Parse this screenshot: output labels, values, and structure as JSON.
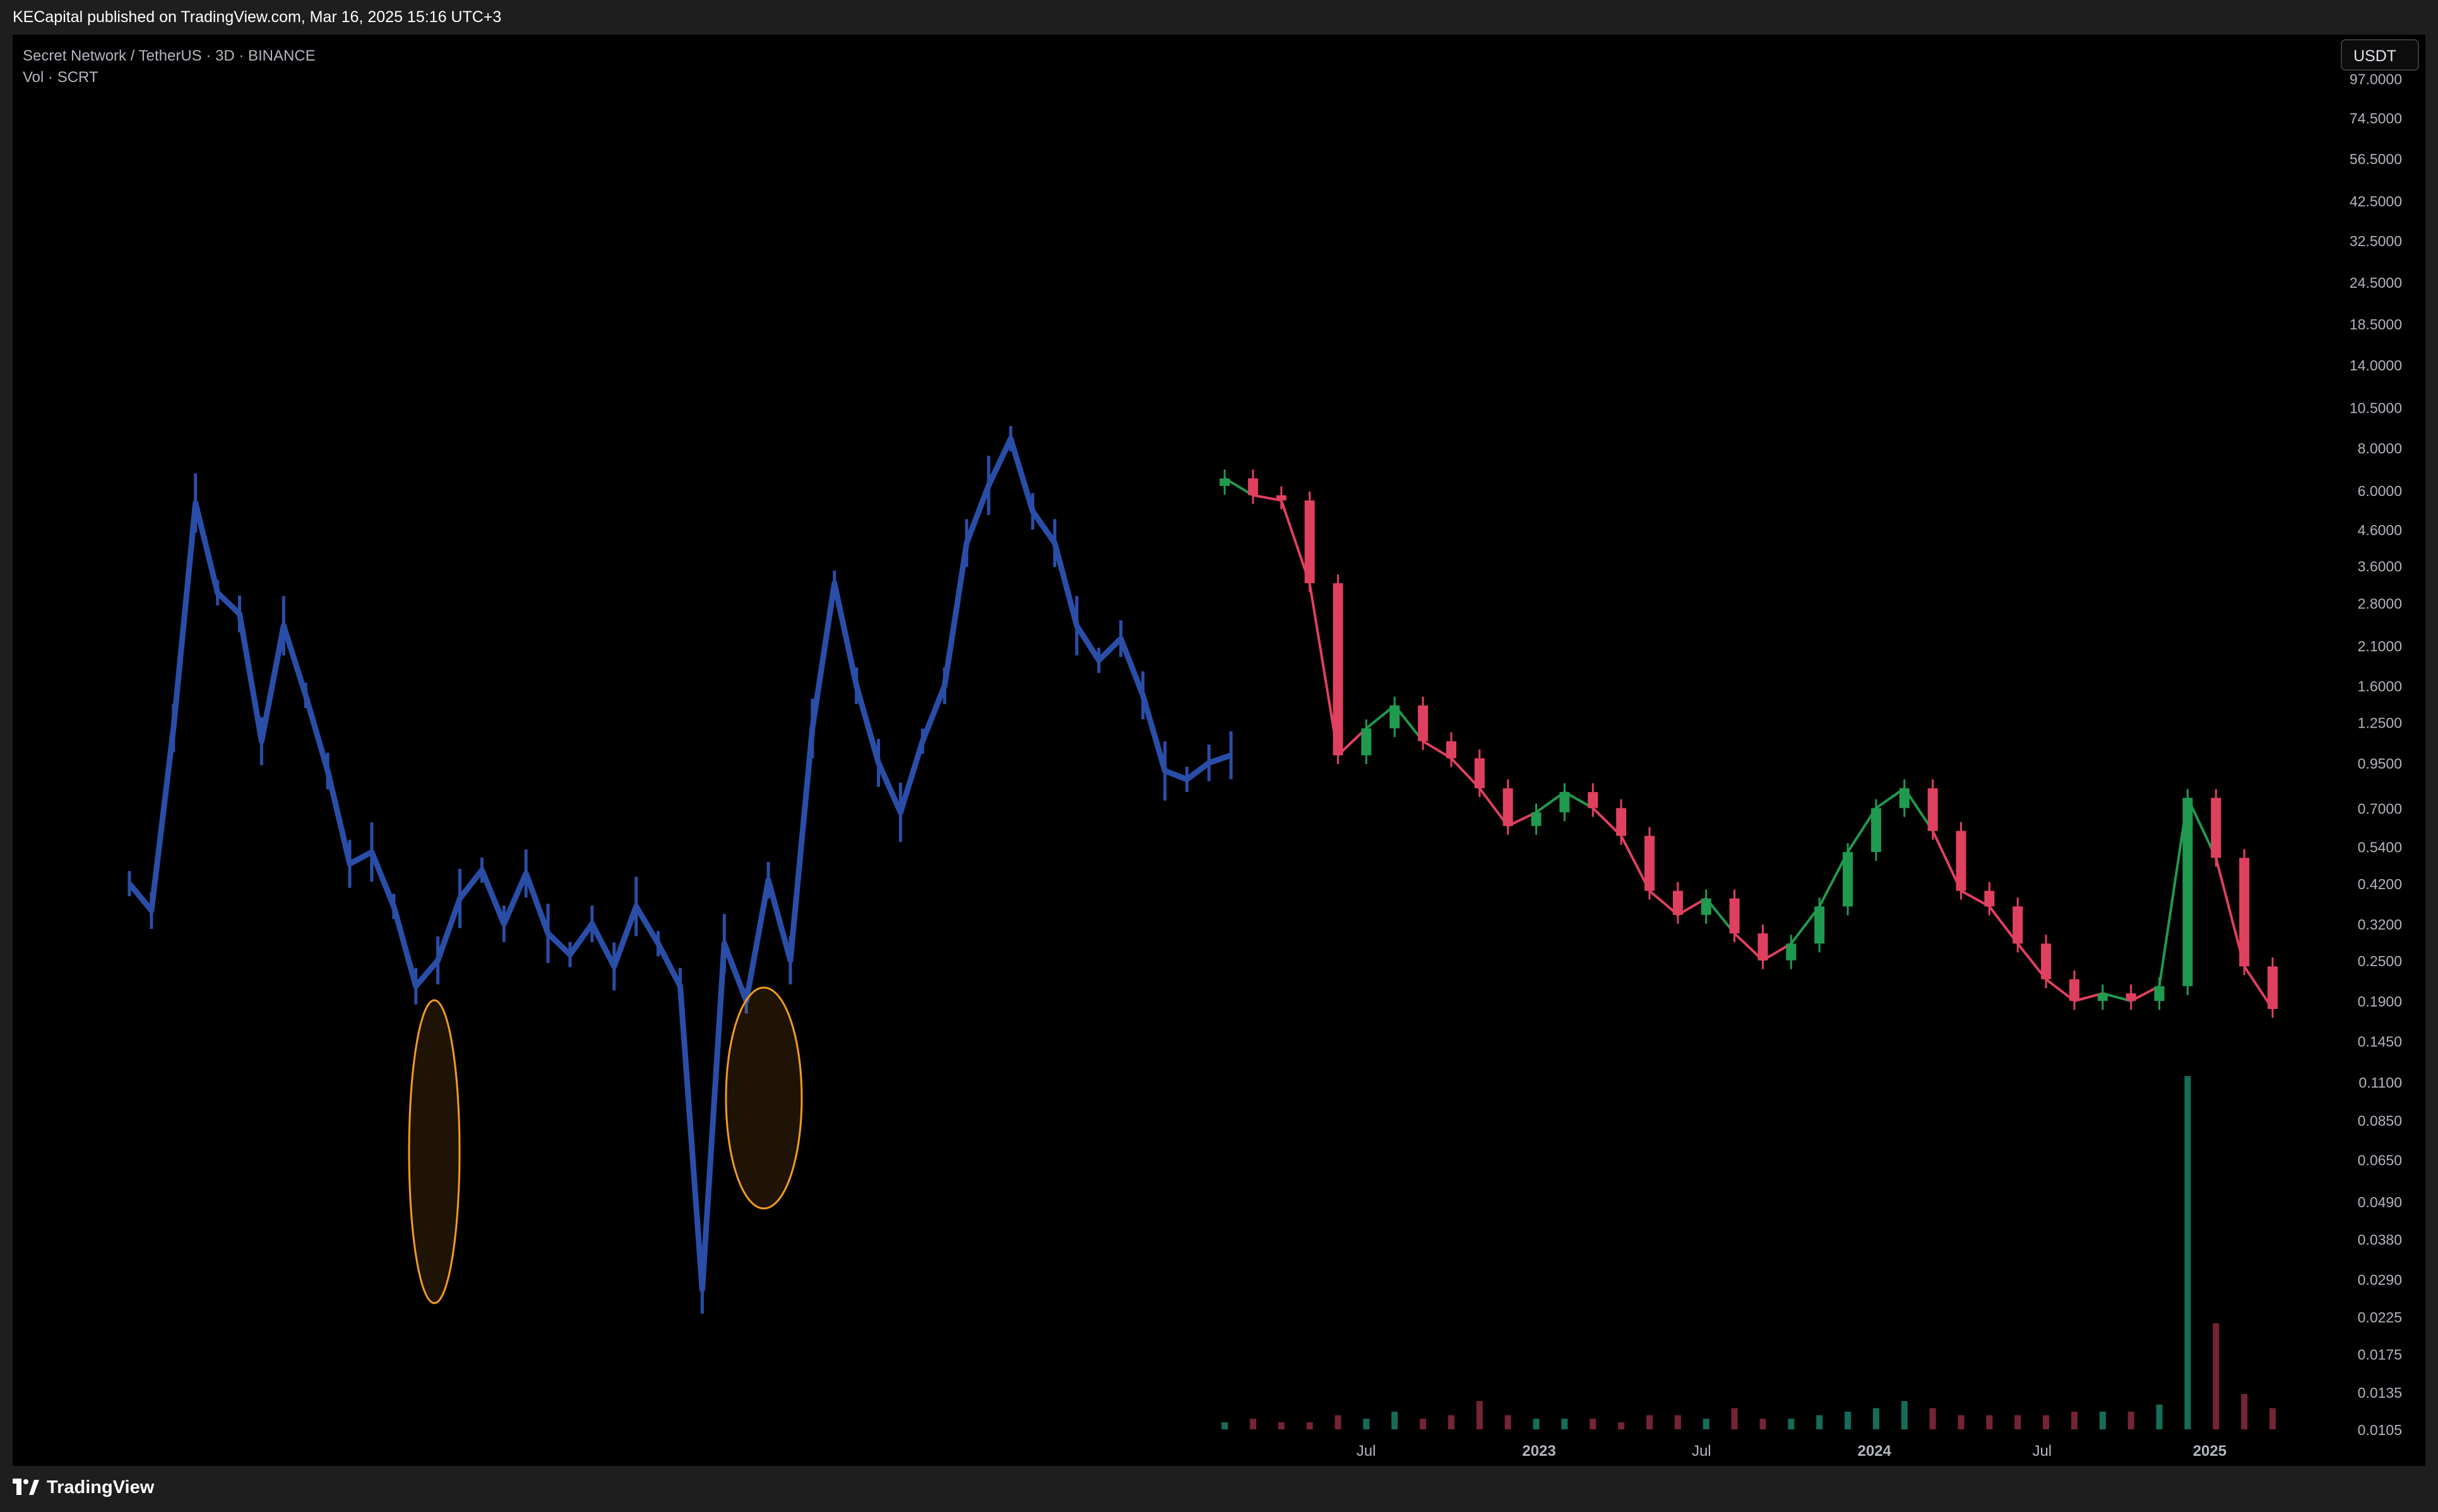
{
  "header": {
    "publisher_line": "KECapital published on TradingView.com, Mar 16, 2025 15:16 UTC+3"
  },
  "legend": {
    "symbol_line": "Secret Network / TetherUS · 3D · BINANCE",
    "volume_line": "Vol · SCRT"
  },
  "currency_button": "USDT",
  "footer": {
    "brand": "TradingView"
  },
  "colors": {
    "background": "#000000",
    "simulated_history": "#2a4ea8",
    "candle_up": "#1f9a4f",
    "candle_down": "#e0405f",
    "highlight_ring": "#f39c1f",
    "axis_text": "#b2b5be"
  },
  "chart_data": {
    "type": "line",
    "title": "Secret Network / TetherUS · 3D · BINANCE",
    "scale": "log",
    "ylim": [
      0.0105,
      125
    ],
    "x_ticks": [
      "Jul",
      "2023",
      "Jul",
      "2024",
      "Jul",
      "2025"
    ],
    "y_ticks": [
      "97.0000",
      "74.5000",
      "56.5000",
      "42.5000",
      "32.5000",
      "24.5000",
      "18.5000",
      "14.0000",
      "10.5000",
      "8.0000",
      "6.0000",
      "4.6000",
      "3.6000",
      "2.8000",
      "2.1000",
      "1.6000",
      "1.2500",
      "0.9500",
      "0.7000",
      "0.5400",
      "0.4200",
      "0.3200",
      "0.2500",
      "0.1900",
      "0.1450",
      "0.1100",
      "0.0850",
      "0.0650",
      "0.0490",
      "0.0380",
      "0.0290",
      "0.0225",
      "0.0175",
      "0.0135",
      "0.0105"
    ],
    "series": [
      {
        "kind": "projected-fractal",
        "color": "#2a4ea8",
        "x": [
          0,
          2,
          4,
          6,
          8,
          10,
          12,
          14,
          16,
          18,
          20,
          22,
          24,
          26,
          28,
          30,
          32,
          34,
          36,
          38,
          40,
          42,
          44,
          46,
          48,
          50,
          52,
          54,
          56,
          58,
          60,
          62,
          64,
          66,
          68,
          70,
          72,
          74,
          76,
          78,
          80,
          82,
          84,
          86,
          88,
          90,
          92,
          94,
          96,
          98,
          100
        ],
        "y": [
          0.42,
          0.35,
          1.2,
          5.5,
          3.0,
          2.6,
          1.1,
          2.4,
          1.5,
          0.9,
          0.48,
          0.52,
          0.36,
          0.21,
          0.25,
          0.38,
          0.46,
          0.32,
          0.45,
          0.3,
          0.26,
          0.32,
          0.24,
          0.36,
          0.28,
          0.21,
          0.027,
          0.28,
          0.19,
          0.43,
          0.25,
          1.2,
          3.2,
          1.6,
          0.95,
          0.68,
          1.1,
          1.6,
          4.2,
          6.2,
          8.5,
          5.2,
          4.2,
          2.4,
          1.9,
          2.2,
          1.5,
          0.9,
          0.85,
          0.95,
          1.0
        ]
      },
      {
        "kind": "actual-candles",
        "color_up": "#1f9a4f",
        "color_down": "#e0405f",
        "x_dates": [
          "2022-02",
          "2022-03",
          "2022-04",
          "2022-05",
          "2022-06",
          "2022-07",
          "2022-08",
          "2022-09",
          "2022-10",
          "2022-11",
          "2022-12",
          "2023-01",
          "2023-02",
          "2023-03",
          "2023-04",
          "2023-05",
          "2023-06",
          "2023-07",
          "2023-08",
          "2023-09",
          "2023-10",
          "2023-11",
          "2023-12",
          "2024-01",
          "2024-02",
          "2024-03",
          "2024-04",
          "2024-05",
          "2024-06",
          "2024-07",
          "2024-08",
          "2024-09",
          "2024-10",
          "2024-11",
          "2024-12",
          "2025-01",
          "2025-02",
          "2025-03"
        ],
        "y": [
          6.5,
          5.8,
          5.6,
          3.2,
          1.0,
          1.2,
          1.4,
          1.1,
          0.98,
          0.8,
          0.62,
          0.68,
          0.78,
          0.7,
          0.58,
          0.4,
          0.34,
          0.38,
          0.3,
          0.25,
          0.28,
          0.36,
          0.52,
          0.7,
          0.8,
          0.6,
          0.4,
          0.36,
          0.28,
          0.22,
          0.19,
          0.2,
          0.19,
          0.21,
          0.75,
          0.5,
          0.24,
          0.18
        ]
      }
    ],
    "volume": {
      "label": "Vol · SCRT",
      "note_peaks_index": [
        34,
        35
      ],
      "relative_values": [
        0.02,
        0.03,
        0.02,
        0.02,
        0.04,
        0.03,
        0.05,
        0.03,
        0.04,
        0.08,
        0.04,
        0.03,
        0.03,
        0.03,
        0.02,
        0.04,
        0.04,
        0.03,
        0.06,
        0.03,
        0.03,
        0.04,
        0.05,
        0.06,
        0.08,
        0.06,
        0.04,
        0.04,
        0.04,
        0.04,
        0.05,
        0.05,
        0.05,
        0.07,
        1.0,
        0.3,
        0.1,
        0.06
      ]
    },
    "annotations": [
      {
        "type": "ellipse",
        "label": ""
      },
      {
        "type": "ellipse",
        "label": ""
      }
    ]
  }
}
